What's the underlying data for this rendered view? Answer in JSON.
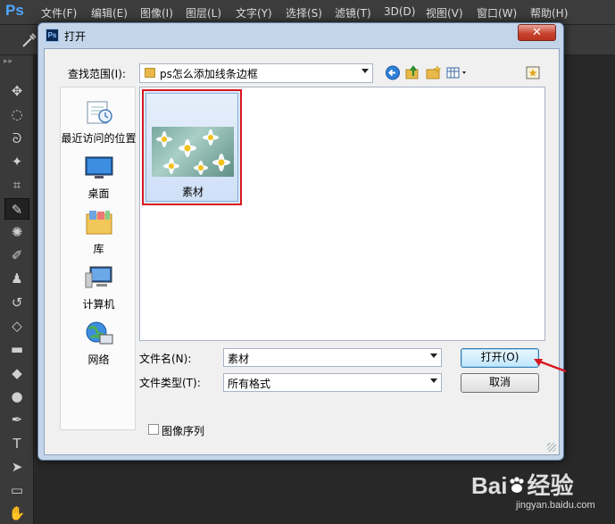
{
  "app": {
    "logo_text": "Ps",
    "menu": [
      "文件(F)",
      "编辑(E)",
      "图像(I)",
      "图层(L)",
      "文字(Y)",
      "选择(S)",
      "滤镜(T)",
      "3D(D)",
      "视图(V)",
      "窗口(W)",
      "帮助(H)"
    ]
  },
  "tools": [
    "move-tool",
    "marquee-tool",
    "lasso-tool",
    "magic-wand-tool",
    "crop-tool",
    "eyedropper-tool",
    "healing-brush-tool",
    "brush-tool",
    "clone-stamp-tool",
    "history-brush-tool",
    "eraser-tool",
    "gradient-tool",
    "blur-tool",
    "dodge-tool",
    "pen-tool",
    "type-tool",
    "path-selection-tool",
    "rectangle-tool",
    "hand-tool"
  ],
  "tool_glyphs": [
    "✥",
    "◌",
    "ᘐ",
    "✦",
    "⌗",
    "✎",
    "✺",
    "✐",
    "♟",
    "↺",
    "◇",
    "▬",
    "◆",
    "●",
    "✒",
    "T",
    "➤",
    "▭",
    "✋"
  ],
  "dialog": {
    "title": "打开",
    "close_label": "✕",
    "look_in_label": "查找范围(I):",
    "current_folder": "ps怎么添加线条边框",
    "places": [
      {
        "label": "最近访问的位置",
        "icon": "recent-places-icon"
      },
      {
        "label": "桌面",
        "icon": "desktop-icon"
      },
      {
        "label": "库",
        "icon": "libraries-icon"
      },
      {
        "label": "计算机",
        "icon": "computer-icon"
      },
      {
        "label": "网络",
        "icon": "network-icon"
      }
    ],
    "files": [
      {
        "name": "素材",
        "selected": true
      }
    ],
    "filename_label": "文件名(N):",
    "filename_value": "素材",
    "filetype_label": "文件类型(T):",
    "filetype_value": "所有格式",
    "open_button": "打开(O)",
    "cancel_button": "取消",
    "image_sequence_label": "图像序列",
    "image_sequence_checked": false
  },
  "watermark": {
    "brand": "Bai",
    "brand_suffix": "经验",
    "url": "jingyan.baidu.com"
  },
  "colors": {
    "highlight": "#d8171f",
    "dialog_frame": "#c4d5ea",
    "accent_blue": "#3c7fb1"
  }
}
